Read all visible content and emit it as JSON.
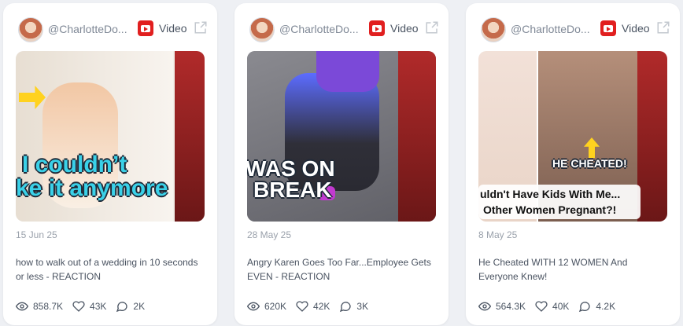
{
  "cards": [
    {
      "handle": "@CharlotteDo...",
      "platform": "Video",
      "date": "15 Jun 25",
      "title": "how to walk out of a wedding in 10 seconds or less - REACTION",
      "views": "858.7K",
      "likes": "43K",
      "comments": "2K",
      "thumb_text_1": "I couldn’t",
      "thumb_text_2": "ke it anymore"
    },
    {
      "handle": "@CharlotteDo...",
      "platform": "Video",
      "date": "28 May 25",
      "title": "Angry Karen Goes Too Far...Employee Gets EVEN - REACTION",
      "views": "620K",
      "likes": "42K",
      "comments": "3K",
      "thumb_text_1": "WAS ON",
      "thumb_text_2": "BREAK"
    },
    {
      "handle": "@CharlotteDo...",
      "platform": "Video",
      "date": "8 May 25",
      "title": "He Cheated WITH 12 WOMEN And Everyone Knew!",
      "views": "564.3K",
      "likes": "40K",
      "comments": "4.2K",
      "thumb_text_1": "uldn't Have Kids With Me...",
      "thumb_text_2": "Other Women Pregnant?!",
      "thumb_badge": "HE CHEATED!"
    }
  ],
  "colors": {
    "youtube_red": "#e11f1f",
    "thumb_cyan": "#3ad1e8",
    "yellow_arrow": "#ffd21f"
  }
}
